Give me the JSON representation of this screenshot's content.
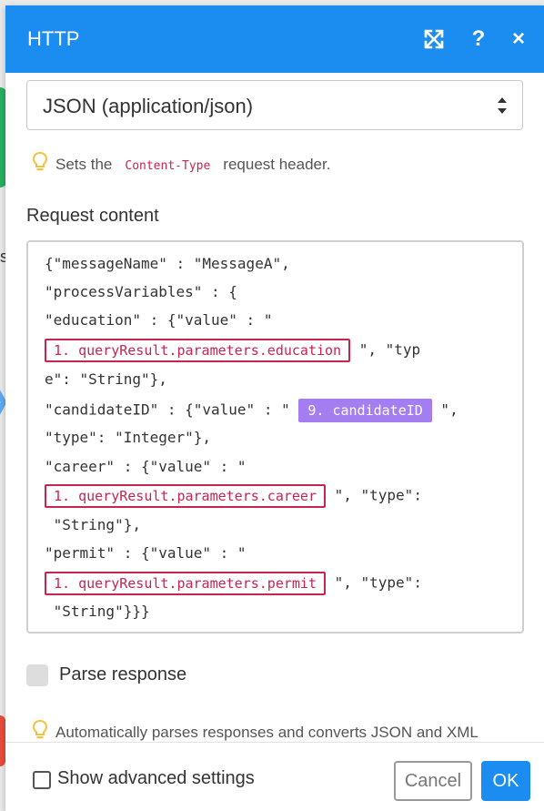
{
  "colors": {
    "header": "#1b8df0",
    "accent": "#1b8df0",
    "pill_outline": "#c7254e",
    "pill_filled": "#a47ef0",
    "hint_bulb": "#f5c140"
  },
  "background": {
    "partial_text": "s"
  },
  "header": {
    "title": "HTTP",
    "icons": [
      "expand-icon",
      "help-icon",
      "close-icon"
    ],
    "help_glyph": "?",
    "close_glyph": "×"
  },
  "body_type_select": {
    "value": "JSON (application/json)"
  },
  "content_type_hint": {
    "before": "Sets the",
    "code": "Content-Type",
    "after": "request header."
  },
  "request_content": {
    "label": "Request content",
    "lines": [
      {
        "text": "{\"messageName\" : \"MessageA\","
      },
      {
        "text": "\"processVariables\" : {"
      },
      {
        "text": "\"education\" : {\"value\" : \""
      },
      {
        "before": "",
        "pill": "1. queryResult.parameters.education",
        "pill_style": "outline",
        "after": " \", \"typ"
      },
      {
        "text": "e\": \"String\"},"
      },
      {
        "before": "\"candidateID\" : {\"value\" : \" ",
        "pill": "9. candidateID",
        "pill_style": "filled",
        "after": " \","
      },
      {
        "text": "\"type\": \"Integer\"},"
      },
      {
        "text": "\"career\" : {\"value\" : \""
      },
      {
        "before": "",
        "pill": "1. queryResult.parameters.career",
        "pill_style": "outline",
        "after": " \", \"type\":"
      },
      {
        "text": " \"String\"},"
      },
      {
        "text": "\"permit\" : {\"value\" : \""
      },
      {
        "before": "",
        "pill": "1. queryResult.parameters.permit",
        "pill_style": "outline",
        "after": " \", \"type\":"
      },
      {
        "text": " \"String\"}}}"
      }
    ]
  },
  "parse_response": {
    "label": "Parse response",
    "enabled": false
  },
  "parse_hint": {
    "text": "Automatically parses responses and converts JSON and XML"
  },
  "footer": {
    "advanced_label": "Show advanced settings",
    "advanced_checked": false,
    "cancel_label": "Cancel",
    "ok_label": "OK"
  }
}
